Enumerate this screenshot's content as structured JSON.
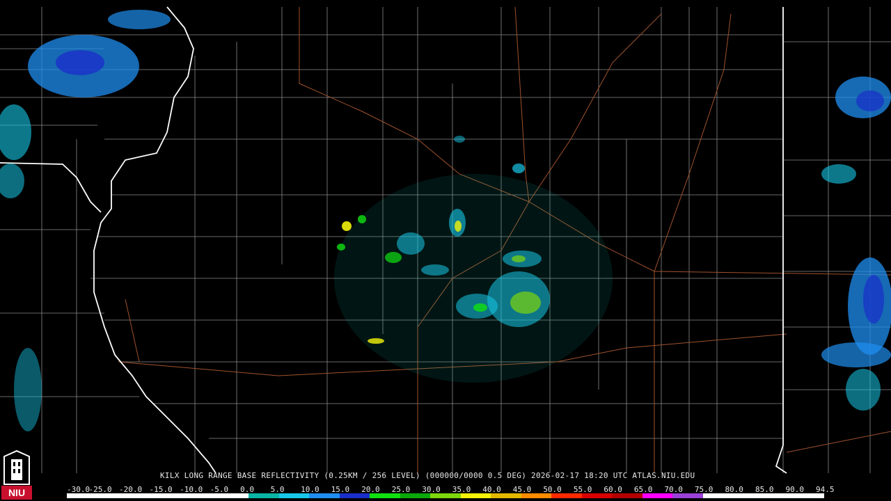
{
  "product": {
    "title": "KILX LONG RANGE BASE REFLECTIVITY (0.25KM / 256 LEVEL) (000000/0000 0.5 DEG) 2026-02-17 18:20 UTC  ATLAS.NIU.EDU"
  },
  "legend": {
    "labels": [
      "-30.0",
      "-25.0",
      "-20.0",
      "-15.0",
      "-10.0",
      "-5.0",
      "0.0",
      "5.0",
      "10.0",
      "15.0",
      "20.0",
      "25.0",
      "30.0",
      "35.0",
      "40.0",
      "45.0",
      "50.0",
      "55.0",
      "60.0",
      "65.0",
      "70.0",
      "75.0",
      "80.0",
      "85.0",
      "90.0",
      "94.5"
    ],
    "colors": [
      "#ffffff",
      "#ffffff",
      "#ffffff",
      "#ffffff",
      "#ffffff",
      "#ffffff",
      "#0bb5a5",
      "#17c8e8",
      "#1f8ef0",
      "#1a2fc9",
      "#10e010",
      "#0aa80a",
      "#7ed60d",
      "#f2f20a",
      "#e3b800",
      "#ff8c00",
      "#ff2a00",
      "#d80000",
      "#b50000",
      "#ff00ff",
      "#9b40d8",
      "#ffffff",
      "#ffffff",
      "#ffffff",
      "#ffffff"
    ]
  },
  "colors": {
    "background": "#000000",
    "county_lines": "#8a8a8a",
    "state_lines": "#ffffff",
    "highways": "#a0522d"
  },
  "logo": {
    "text": "NIU"
  }
}
